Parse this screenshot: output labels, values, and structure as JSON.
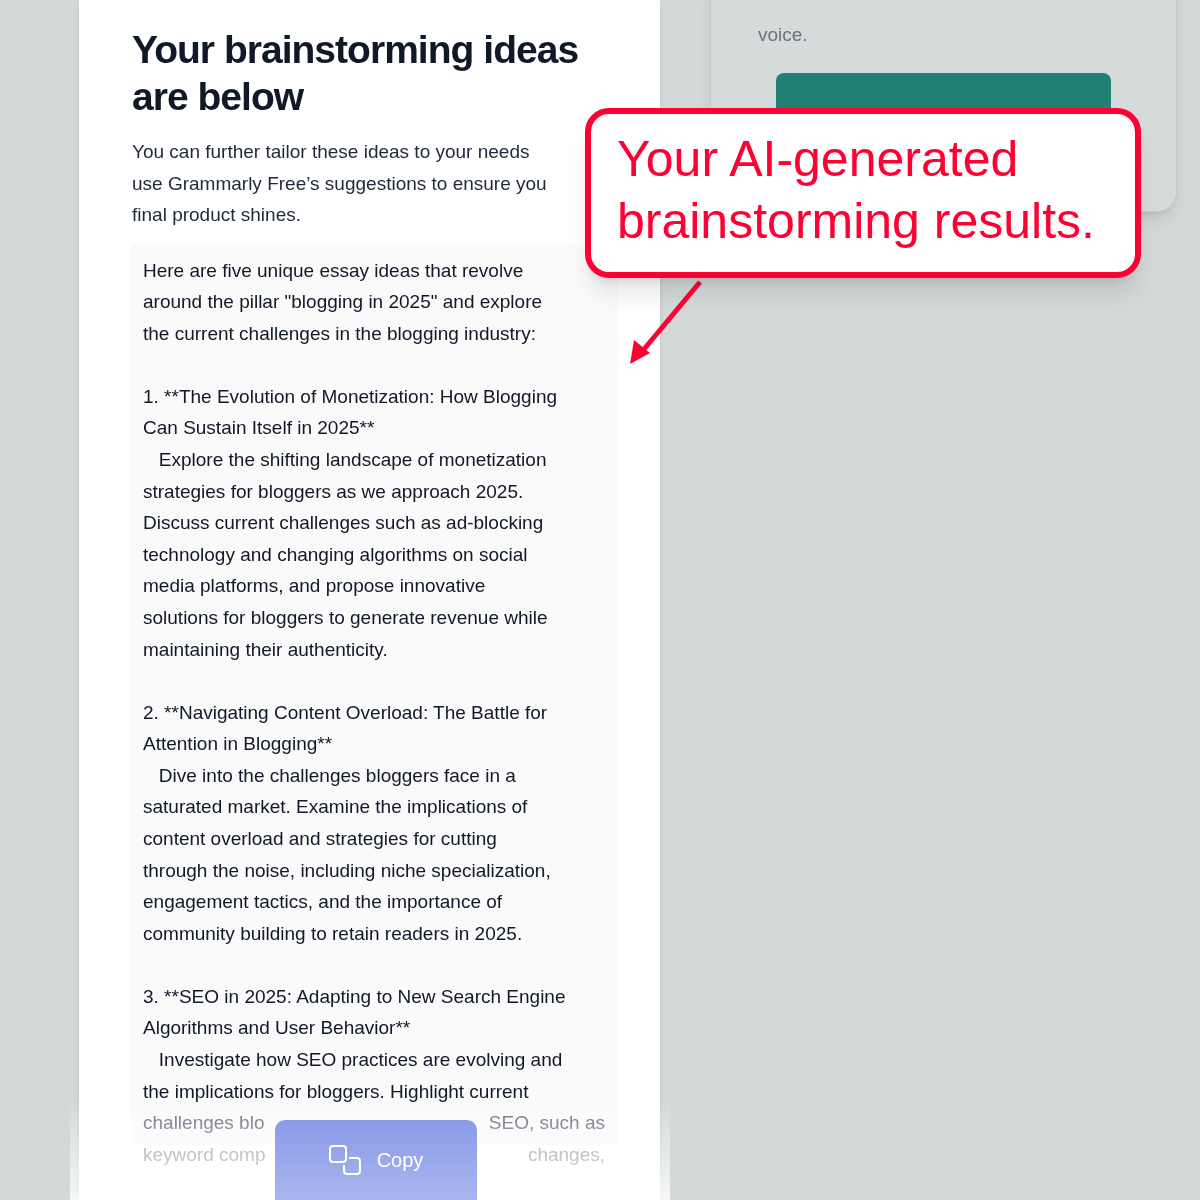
{
  "heading": "Your brainstorming ideas are below",
  "intro": [
    "You can further tailor these ideas to your needs",
    "use Grammarly Free’s suggestions to ensure you",
    "final product shines."
  ],
  "side_card": {
    "lines": [
      "voice."
    ]
  },
  "result": {
    "paragraphs": [
      [
        "Here are five unique essay ideas that revolve",
        "around the pillar \"blogging in 2025\" and explore",
        "the current challenges in the blogging industry:"
      ],
      [
        "1. **The Evolution of Monetization: How Blogging",
        "Can Sustain Itself in 2025**",
        "   Explore the shifting landscape of monetization",
        "strategies for bloggers as we approach 2025.",
        "Discuss current challenges such as ad-blocking",
        "technology and changing algorithms on social",
        "media platforms, and propose innovative",
        "solutions for bloggers to generate revenue while",
        "maintaining their authenticity."
      ],
      [
        "2. **Navigating Content Overload: The Battle for",
        "Attention in Blogging**",
        "   Dive into the challenges bloggers face in a",
        "saturated market. Examine the implications of",
        "content overload and strategies for cutting",
        "through the noise, including niche specialization,",
        "engagement tactics, and the importance of",
        "community building to retain readers in 2025."
      ],
      [
        "3. **SEO in 2025: Adapting to New Search Engine",
        "Algorithms and User Behavior**",
        "   Investigate how SEO practices are evolving and",
        "the implications for bloggers. Highlight current"
      ]
    ],
    "faded_lines": [
      {
        "left": "challenges blo",
        "right": "SEO, such as"
      },
      {
        "left": "keyword comp",
        "right": "changes,"
      }
    ]
  },
  "copy_button": {
    "label": "Copy"
  },
  "callout": {
    "lines": [
      "Your AI-generated",
      "brainstorming results."
    ]
  }
}
